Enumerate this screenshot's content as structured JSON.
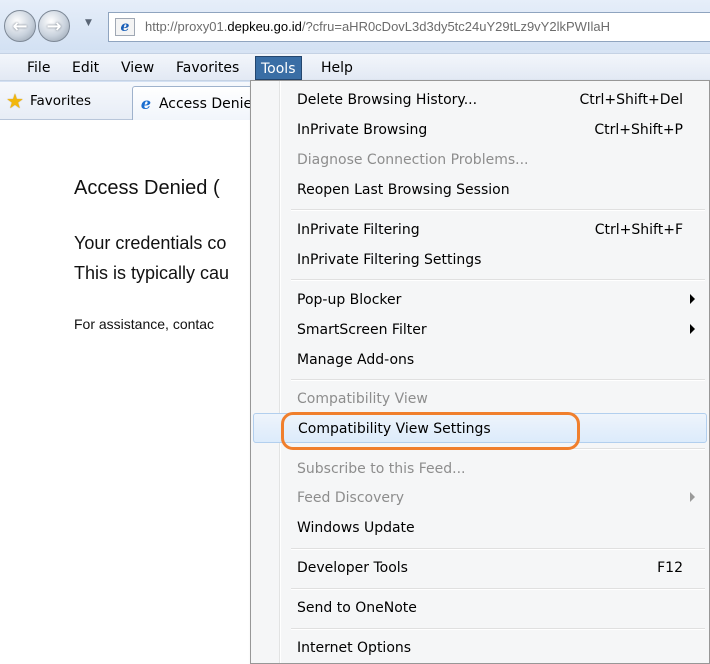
{
  "address_bar": {
    "url_host_prefix": "http://proxy01.",
    "url_host_bold": "depkeu.go.id",
    "url_rest": "/?cfru=aHR0cDovL3d3dy5tc24uY29tLz9vY2lkPWIlaH"
  },
  "menubar": {
    "items": [
      {
        "label": "File"
      },
      {
        "label": "Edit"
      },
      {
        "label": "View"
      },
      {
        "label": "Favorites"
      },
      {
        "label": "Tools"
      },
      {
        "label": "Help"
      }
    ]
  },
  "favorites_bar": {
    "favorites_label": "Favorites",
    "tab_label": "Access Denied"
  },
  "page": {
    "title": "Access Denied (",
    "line1": "Your credentials co",
    "line2": "This is typically cau",
    "help": "For assistance, contac"
  },
  "tools_menu": {
    "items": [
      {
        "label": "Delete Browsing History...",
        "shortcut": "Ctrl+Shift+Del",
        "enabled": true
      },
      {
        "label": "InPrivate Browsing",
        "shortcut": "Ctrl+Shift+P",
        "enabled": true
      },
      {
        "label": "Diagnose Connection Problems...",
        "shortcut": "",
        "enabled": false
      },
      {
        "label": "Reopen Last Browsing Session",
        "shortcut": "",
        "enabled": true
      },
      {
        "label": "InPrivate Filtering",
        "shortcut": "Ctrl+Shift+F",
        "enabled": true
      },
      {
        "label": "InPrivate Filtering Settings",
        "shortcut": "",
        "enabled": true
      },
      {
        "label": "Pop-up Blocker",
        "shortcut": "",
        "enabled": true,
        "submenu": true
      },
      {
        "label": "SmartScreen Filter",
        "shortcut": "",
        "enabled": true,
        "submenu": true
      },
      {
        "label": "Manage Add-ons",
        "shortcut": "",
        "enabled": true
      },
      {
        "label": "Compatibility View",
        "shortcut": "",
        "enabled": false
      },
      {
        "label": "Compatibility View Settings",
        "shortcut": "",
        "enabled": true,
        "hovered": true
      },
      {
        "label": "Subscribe to this Feed...",
        "shortcut": "",
        "enabled": false
      },
      {
        "label": "Feed Discovery",
        "shortcut": "",
        "enabled": false,
        "submenu": true
      },
      {
        "label": "Windows Update",
        "shortcut": "",
        "enabled": true
      },
      {
        "label": "Developer Tools",
        "shortcut": "F12",
        "enabled": true
      },
      {
        "label": "Send to OneNote",
        "shortcut": "",
        "enabled": true
      },
      {
        "label": "Internet Options",
        "shortcut": "",
        "enabled": true
      }
    ]
  },
  "colors": {
    "highlight_ring": "#f07f2d",
    "menu_active": "#3a6ea5"
  }
}
